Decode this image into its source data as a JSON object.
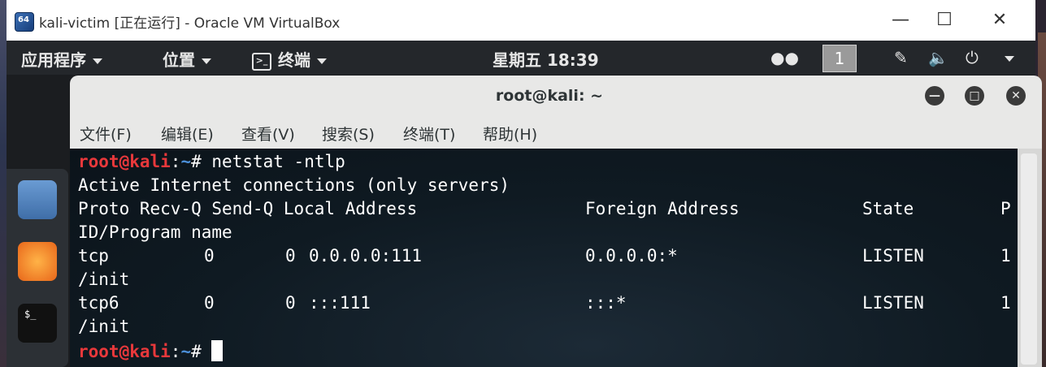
{
  "vbox": {
    "title": "kali-victim [正在运行] - Oracle VM VirtualBox",
    "logo_text": "64",
    "minimize": "—",
    "maximize": "☐",
    "close": "✕"
  },
  "gnome": {
    "apps_menu": "应用程序",
    "places_menu": "位置",
    "terminal_menu": "终端",
    "clock": "星期五 18:39",
    "workspace": "1"
  },
  "terminal": {
    "title": "root@kali: ~",
    "menus": [
      "文件(F)",
      "编辑(E)",
      "查看(V)",
      "搜索(S)",
      "终端(T)",
      "帮助(H)"
    ],
    "prompt_user": "root@kali",
    "prompt_sep": ":",
    "prompt_path": "~",
    "prompt_hash": "# ",
    "command": "netstat -ntlp",
    "output_header": "Active Internet connections (only servers)",
    "columns": {
      "proto": "Proto Recv-Q Send-Q Local Address",
      "foreign": "Foreign Address",
      "state": "State",
      "pid": "P",
      "pid_wrap": "ID/Program name"
    },
    "rows": [
      {
        "proto": "tcp",
        "recvq": "0",
        "sendq": "0",
        "local": "0.0.0.0:111",
        "foreign": "0.0.0.0:*",
        "state": "LISTEN",
        "pid": "1",
        "wrap": "/init"
      },
      {
        "proto": "tcp6",
        "recvq": "0",
        "sendq": "0",
        "local": ":::111",
        "foreign": ":::*",
        "state": "LISTEN",
        "pid": "1",
        "wrap": "/init"
      }
    ]
  },
  "colors": {
    "prompt_user": "#e8383b",
    "prompt_path": "#4b8fd8",
    "gnome_bar": "#24272b"
  }
}
